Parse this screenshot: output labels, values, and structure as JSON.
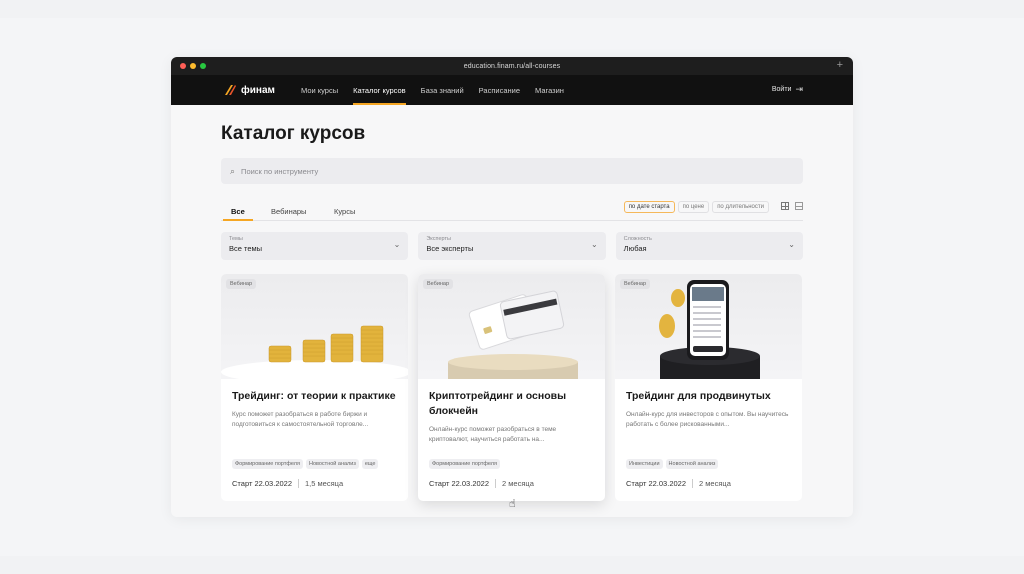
{
  "browser": {
    "url": "education.finam.ru/all-courses",
    "new_tab": "+"
  },
  "header": {
    "logo_text": "финам",
    "nav": [
      {
        "label": "Мои курсы",
        "active": false
      },
      {
        "label": "Каталог курсов",
        "active": true
      },
      {
        "label": "База знаний",
        "active": false
      },
      {
        "label": "Расписание",
        "active": false
      },
      {
        "label": "Магазин",
        "active": false
      }
    ],
    "login_label": "Войти"
  },
  "page": {
    "title": "Каталог курсов",
    "search_placeholder": "Поиск по инструменту",
    "tabs": [
      {
        "label": "Все",
        "active": true
      },
      {
        "label": "Вебинары",
        "active": false
      },
      {
        "label": "Курсы",
        "active": false
      }
    ],
    "sort": [
      {
        "label": "по дате старта",
        "active": true
      },
      {
        "label": "по цене",
        "active": false
      },
      {
        "label": "по длительности",
        "active": false
      }
    ],
    "filters": [
      {
        "label": "Темы",
        "value": "Все темы"
      },
      {
        "label": "Эксперты",
        "value": "Все эксперты"
      },
      {
        "label": "Сложность",
        "value": "Любая"
      }
    ]
  },
  "cards": [
    {
      "badge": "Вебинар",
      "title": "Трейдинг: от теории к практике",
      "desc": "Курс поможет разобраться в работе биржи и подготовиться к самостоятельной торговле...",
      "tags": [
        "Формирование портфеля",
        "Новостной анализ",
        "еще"
      ],
      "start": "Старт 22.03.2022",
      "duration": "1,5 месяца"
    },
    {
      "badge": "Вебинар",
      "title": "Криптотрейдинг и основы блокчейн",
      "desc": "Онлайн-курс поможет разобраться в теме криптовалют, научиться работать на...",
      "tags": [
        "Формирование портфеля"
      ],
      "start": "Старт 22.03.2022",
      "duration": "2 месяца"
    },
    {
      "badge": "Вебинар",
      "title": "Трейдинг для продвинутых",
      "desc": "Онлайн-курс для инвесторов с опытом. Вы научитесь работать с более рискованными...",
      "tags": [
        "Инвестиции",
        "Новостной анализ"
      ],
      "start": "Старт 22.03.2022",
      "duration": "2 месяца"
    }
  ],
  "colors": {
    "accent": "#f5a623",
    "nav_bg": "#111111",
    "titlebar_bg": "#1e1e1e"
  }
}
